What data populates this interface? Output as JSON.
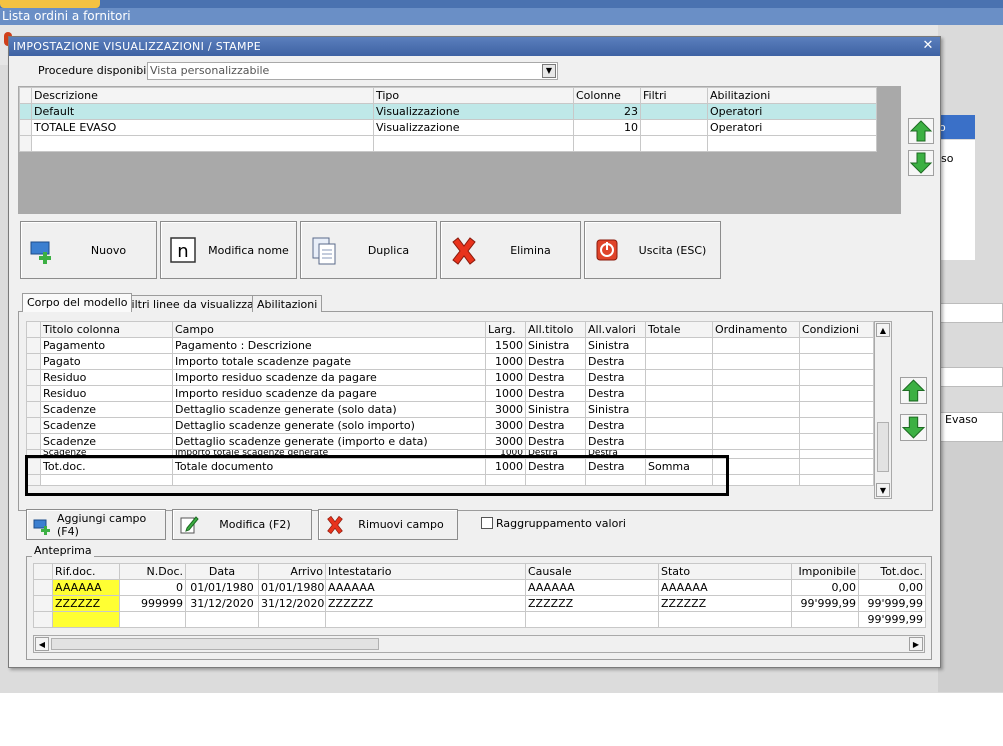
{
  "background": {
    "window_title": "Lista ordini a fornitori",
    "right_label_evaso": "Evaso",
    "right_fragment_1": "o",
    "right_fragment_2": "so"
  },
  "dialog": {
    "title": "IMPOSTAZIONE VISUALIZZAZIONI / STAMPE",
    "procedure_label": "Procedure disponibili :",
    "procedure_value": "Vista personalizzabile",
    "views_grid": {
      "columns": [
        "Descrizione",
        "Tipo",
        "Colonne",
        "Filtri",
        "Abilitazioni"
      ],
      "rows": [
        [
          "Default",
          "Visualizzazione",
          "23",
          "",
          "Operatori"
        ],
        [
          "TOTALE EVASO",
          "Visualizzazione",
          "10",
          "",
          "Operatori"
        ]
      ]
    },
    "buttons": {
      "nuovo": "Nuovo",
      "modifica_nome": "Modifica nome",
      "duplica": "Duplica",
      "elimina": "Elimina",
      "uscita": "Uscita (ESC)"
    },
    "tabs": [
      "Corpo del modello",
      "Filtri linee da visualizzare",
      "Abilitazioni"
    ],
    "fields_grid": {
      "columns": [
        "Titolo colonna",
        "Campo",
        "Larg.",
        "All.titolo",
        "All.valori",
        "Totale",
        "Ordinamento",
        "Condizioni"
      ],
      "rows": [
        [
          "Pagamento",
          "Pagamento : Descrizione",
          "1500",
          "Sinistra",
          "Sinistra",
          "",
          "",
          ""
        ],
        [
          "Pagato",
          "Importo totale scadenze pagate",
          "1000",
          "Destra",
          "Destra",
          "",
          "",
          ""
        ],
        [
          "Residuo",
          "Importo residuo scadenze da pagare",
          "1000",
          "Destra",
          "Destra",
          "",
          "",
          ""
        ],
        [
          "Residuo",
          "Importo residuo scadenze da pagare",
          "1000",
          "Destra",
          "Destra",
          "",
          "",
          ""
        ],
        [
          "Scadenze",
          "Dettaglio scadenze generate (solo data)",
          "3000",
          "Sinistra",
          "Sinistra",
          "",
          "",
          ""
        ],
        [
          "Scadenze",
          "Dettaglio scadenze generate (solo importo)",
          "3000",
          "Destra",
          "Destra",
          "",
          "",
          ""
        ],
        [
          "Scadenze",
          "Dettaglio scadenze generate (importo e data)",
          "3000",
          "Destra",
          "Destra",
          "",
          "",
          ""
        ],
        [
          "Scadenze",
          "Importo totale scadenze generate",
          "1000",
          "Destra",
          "Destra",
          "",
          "",
          ""
        ],
        [
          "Tot.doc.",
          "Totale documento",
          "1000",
          "Destra",
          "Destra",
          "Somma",
          "",
          ""
        ],
        [
          "",
          "",
          "",
          "",
          "",
          "",
          "",
          ""
        ]
      ]
    },
    "field_buttons": {
      "aggiungi": "Aggiungi campo (F4)",
      "modifica": "Modifica (F2)",
      "rimuovi": "Rimuovi campo"
    },
    "raggruppamento_label": "Raggruppamento valori",
    "preview": {
      "label": "Anteprima",
      "columns": [
        "Rif.doc.",
        "N.Doc.",
        "Data",
        "Arrivo",
        "Intestatario",
        "Causale",
        "Stato",
        "Imponibile",
        "Tot.doc."
      ],
      "rows": [
        [
          "AAAAAA",
          "0",
          "01/01/1980",
          "01/01/1980",
          "AAAAAA",
          "AAAAAA",
          "AAAAAA",
          "0,00",
          "0,00"
        ],
        [
          "ZZZZZZ",
          "999999",
          "31/12/2020",
          "31/12/2020",
          "ZZZZZZ",
          "ZZZZZZ",
          "ZZZZZZ",
          "99'999,99",
          "99'999,99"
        ],
        [
          "",
          "",
          "",
          "",
          "",
          "",
          "",
          "",
          "99'999,99"
        ]
      ]
    }
  },
  "colors": {
    "title_bar": "#4a6eae",
    "selected_row": "#bfe8e8",
    "highlight_yellow": "#ffff33",
    "highlight_box": "#000000"
  }
}
